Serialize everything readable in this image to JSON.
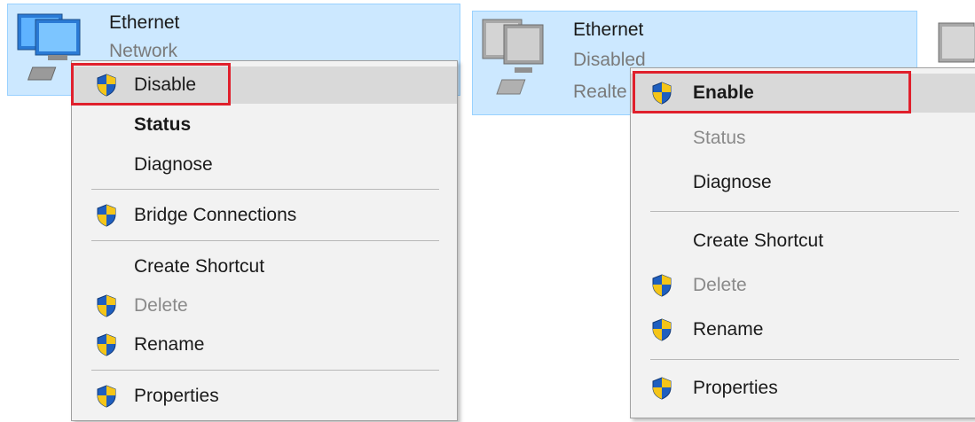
{
  "left_adapter": {
    "name": "Ethernet",
    "status": "Network"
  },
  "left_menu": {
    "items": [
      {
        "label": "Disable",
        "shield": true,
        "highlighted": true
      },
      {
        "label": "Status",
        "bold": true
      },
      {
        "label": "Diagnose"
      },
      {
        "label": "Bridge Connections",
        "shield": true
      },
      {
        "label": "Create Shortcut"
      },
      {
        "label": "Delete",
        "shield": true,
        "disabled": true
      },
      {
        "label": "Rename",
        "shield": true
      },
      {
        "label": "Properties",
        "shield": true
      }
    ]
  },
  "right_adapter": {
    "name": "Ethernet",
    "status": "Disabled",
    "driver": "Realte"
  },
  "right_menu": {
    "items": [
      {
        "label": "Enable",
        "shield": true,
        "highlighted": true,
        "bold": true
      },
      {
        "label": "Status",
        "disabled": true
      },
      {
        "label": "Diagnose"
      },
      {
        "label": "Create Shortcut"
      },
      {
        "label": "Delete",
        "shield": true,
        "disabled": true
      },
      {
        "label": "Rename",
        "shield": true
      },
      {
        "label": "Properties",
        "shield": true
      }
    ]
  },
  "colors": {
    "selection_bg": "#cce8ff",
    "menu_bg": "#f2f2f2",
    "highlight_bg": "#d9d9d9",
    "callout_red": "#e0202c",
    "shield_blue": "#1f5fbf",
    "shield_yellow": "#f5c518"
  }
}
